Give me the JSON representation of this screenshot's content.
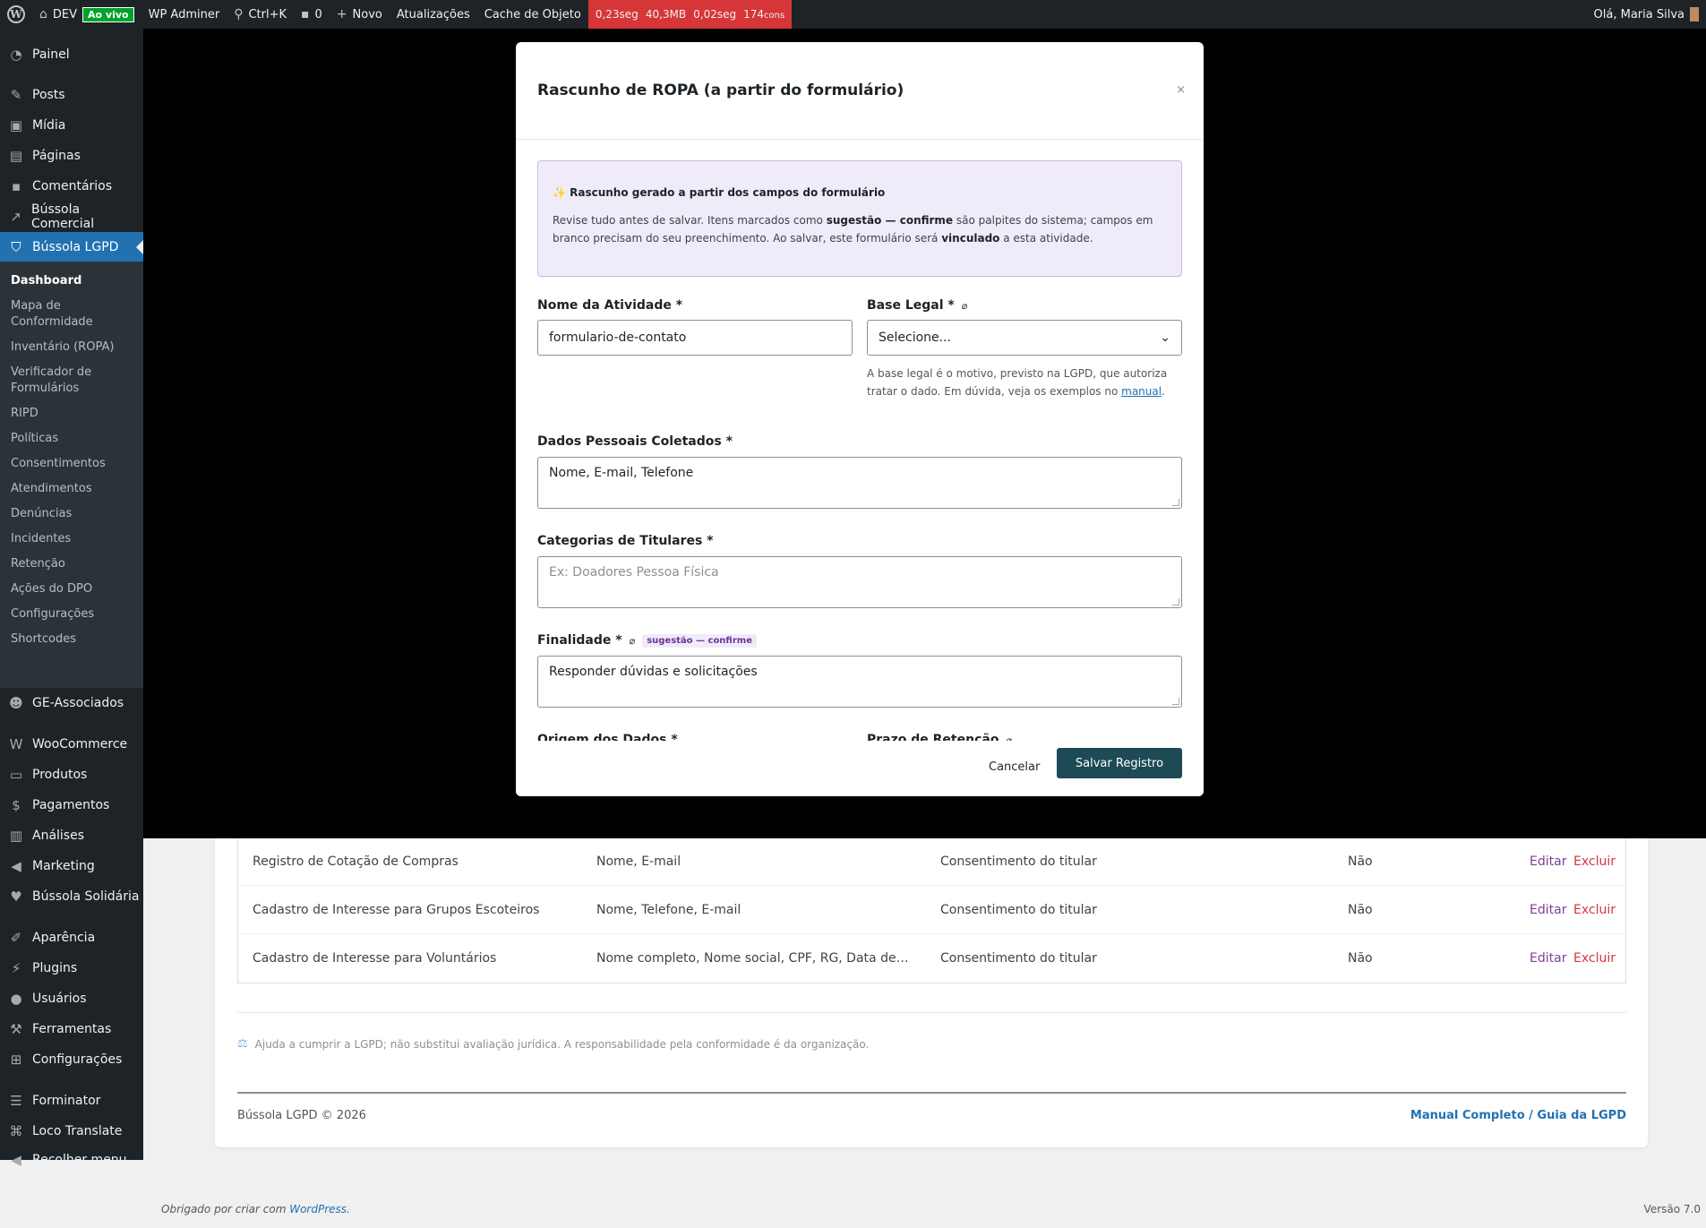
{
  "adminbar": {
    "site_name": "DEV",
    "live_badge": "Ao vivo",
    "adminer": "WP Adminer",
    "search_shortcut": "Ctrl+K",
    "comments_count": "0",
    "new_label": "Novo",
    "updates": "Atualizações",
    "object_cache": "Cache de Objeto",
    "perf": {
      "time": "0,23seg",
      "memory": "40,3MB",
      "db_time": "0,02seg",
      "queries": "174",
      "queries_unit": "cons"
    },
    "greeting": "Olá, Maria Silva"
  },
  "menu": {
    "painel": "Painel",
    "posts": "Posts",
    "midia": "Mídia",
    "paginas": "Páginas",
    "comentarios": "Comentários",
    "bussola_comercial": "Bússola Comercial",
    "bussola_lgpd": "Bússola LGPD",
    "ge_associados": "GE-Associados",
    "woocommerce": "WooCommerce",
    "produtos": "Produtos",
    "pagamentos": "Pagamentos",
    "analises": "Análises",
    "marketing": "Marketing",
    "bussola_solidaria": "Bússola Solidária",
    "aparencia": "Aparência",
    "plugins": "Plugins",
    "usuarios": "Usuários",
    "ferramentas": "Ferramentas",
    "configuracoes": "Configurações",
    "forminator": "Forminator",
    "loco_translate": "Loco Translate",
    "recolher_menu": "Recolher menu"
  },
  "submenu": {
    "dashboard": "Dashboard",
    "mapa": "Mapa de Conformidade",
    "inventario": "Inventário (ROPA)",
    "verificador": "Verificador de Formulários",
    "ripd": "RIPD",
    "politicas": "Políticas",
    "consentimentos": "Consentimentos",
    "atendimentos": "Atendimentos",
    "denuncias": "Denúncias",
    "incidentes": "Incidentes",
    "retencao": "Retenção",
    "acoes_dpo": "Ações do DPO",
    "configuracoes": "Configurações",
    "shortcodes": "Shortcodes"
  },
  "table": {
    "rows": [
      {
        "name": "Registro de Cotação de Compras",
        "data": "Nome, E-mail",
        "basis": "Consentimento do titular",
        "flag": "Não",
        "edit": "Editar",
        "delete": "Excluir"
      },
      {
        "name": "Cadastro de Interesse para Grupos Escoteiros",
        "data": "Nome, Telefone, E-mail",
        "basis": "Consentimento do titular",
        "flag": "Não",
        "edit": "Editar",
        "delete": "Excluir"
      },
      {
        "name": "Cadastro de Interesse para Voluntários",
        "data": "Nome completo, Nome social, CPF, RG, Data de Nasci…",
        "basis": "Consentimento do titular",
        "flag": "Não",
        "edit": "Editar",
        "delete": "Excluir"
      }
    ]
  },
  "disclaimer": "Ajuda a cumprir a LGPD; não substitui avaliação jurídica. A responsabilidade pela conformidade é da organização.",
  "plugin_footer": {
    "copyright": "Bússola LGPD © 2026",
    "manual_link": "Manual Completo / Guia da LGPD"
  },
  "wp_footer": {
    "thanks_prefix": "Obrigado por criar com ",
    "wordpress_link": "WordPress",
    "thanks_suffix": ".",
    "version": "Versão 7.0"
  },
  "modal": {
    "title": "Rascunho de ROPA (a partir do formulário)",
    "close": "×",
    "notice": {
      "title": "✨ Rascunho gerado a partir dos campos do formulário",
      "t1": "Revise tudo antes de salvar. Itens marcados como ",
      "b1": "sugestão — confirme",
      "t2": " são palpites do sistema; campos em branco precisam do seu preenchimento. Ao salvar, este formulário será ",
      "b2": "vinculado",
      "t3": " a esta atividade."
    },
    "fields": {
      "activity_name_label": "Nome da Atividade *",
      "activity_name_value": "formulario-de-contato",
      "legal_basis_label": "Base Legal *",
      "legal_basis_value": "Selecione...",
      "legal_basis_help": "A base legal é o motivo, previsto na LGPD, que autoriza tratar o dado. Em dúvida, veja os exemplos no ",
      "legal_basis_help_link": "manual",
      "legal_basis_help_end": ".",
      "personal_data_label": "Dados Pessoais Coletados *",
      "personal_data_value": "Nome, E-mail, Telefone",
      "subjects_label": "Categorias de Titulares *",
      "subjects_placeholder": "Ex: Doadores Pessoa Física",
      "purpose_label": "Finalidade *",
      "purpose_badge": "sugestão — confirme",
      "purpose_value": "Responder dúvidas e solicitações",
      "origin_label": "Origem dos Dados *",
      "retention_label": "Prazo de Retenção"
    },
    "cancel": "Cancelar",
    "save": "Salvar Registro"
  }
}
